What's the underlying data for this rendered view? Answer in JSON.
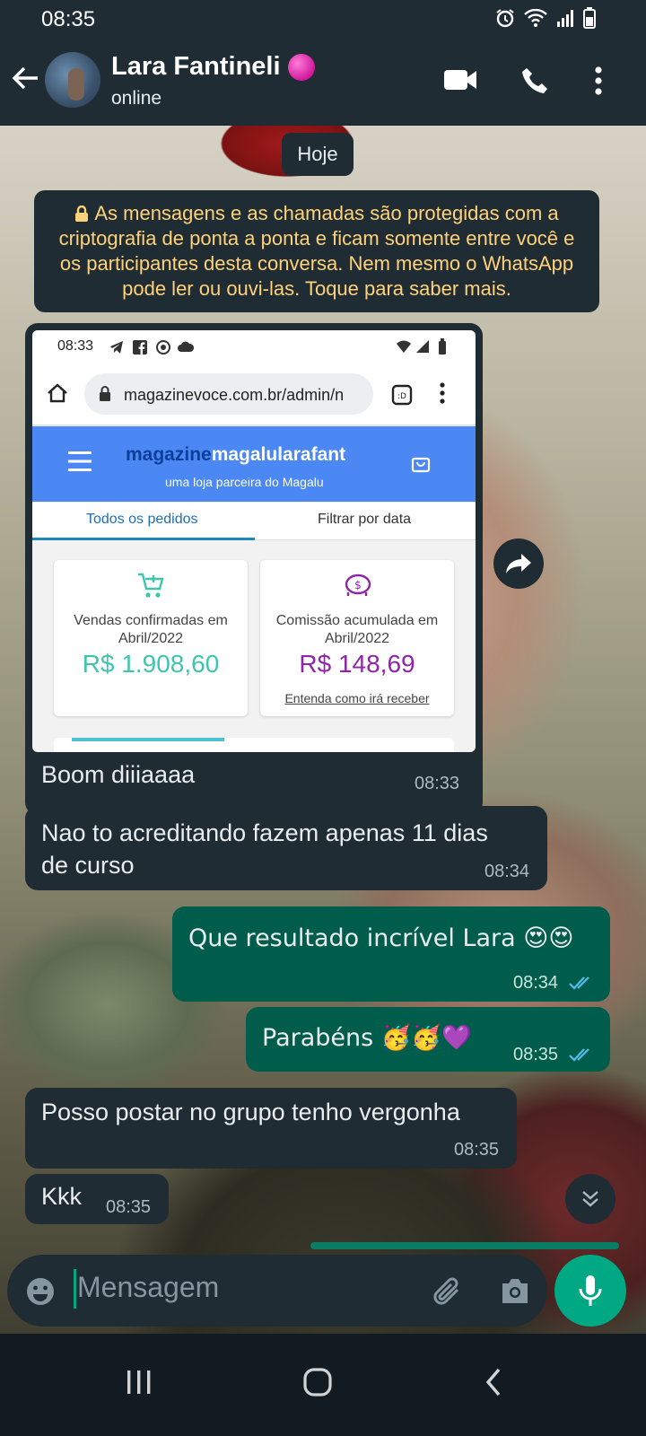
{
  "status_bar": {
    "time": "08:35"
  },
  "header": {
    "contact_name": "Lara Fantineli",
    "contact_status": "online"
  },
  "chat": {
    "date_chip": "Hoje",
    "encryption_notice": "As mensagens e as chamadas são protegidas com a criptografia de ponta a ponta e ficam somente entre você e os participantes desta conversa. Nem mesmo o WhatsApp pode ler ou ouvi-las. Toque para saber mais.",
    "image_message": {
      "screenshot": {
        "time": "08:33",
        "url": "magazinevoce.com.br/admin/n",
        "brand_prefix": "magazine",
        "brand_name": "magalularafant",
        "brand_subtitle": "uma loja parceira do Magalu",
        "tab_active": "Todos os pedidos",
        "tab_other": "Filtrar por data",
        "card1_label": "Vendas confirmadas em Abril/2022",
        "card1_value": "R$ 1.908,60",
        "card2_label": "Comissão acumulada em Abril/2022",
        "card2_value": "R$ 148,69",
        "card2_link": "Entenda como irá receber"
      },
      "caption": "Boom diiiaaaa",
      "time": "08:33"
    },
    "messages": [
      {
        "direction": "in",
        "text": "Nao to acreditando fazem apenas 11 dias de curso",
        "time": "08:34"
      },
      {
        "direction": "out",
        "text": "Que resultado incrível Lara 😍😍",
        "time": "08:34"
      },
      {
        "direction": "out",
        "text": "Parabéns 🥳🥳💜",
        "time": "08:35"
      },
      {
        "direction": "in",
        "text": "Posso postar no grupo tenho vergonha",
        "time": "08:35"
      },
      {
        "direction": "in",
        "text": "Kkk",
        "time": "08:35"
      }
    ]
  },
  "composer": {
    "placeholder": "Mensagem"
  },
  "colors": {
    "accent": "#00a884",
    "incoming": "#1f2c34",
    "outgoing": "#005c4b",
    "notice": "#ffd279"
  }
}
